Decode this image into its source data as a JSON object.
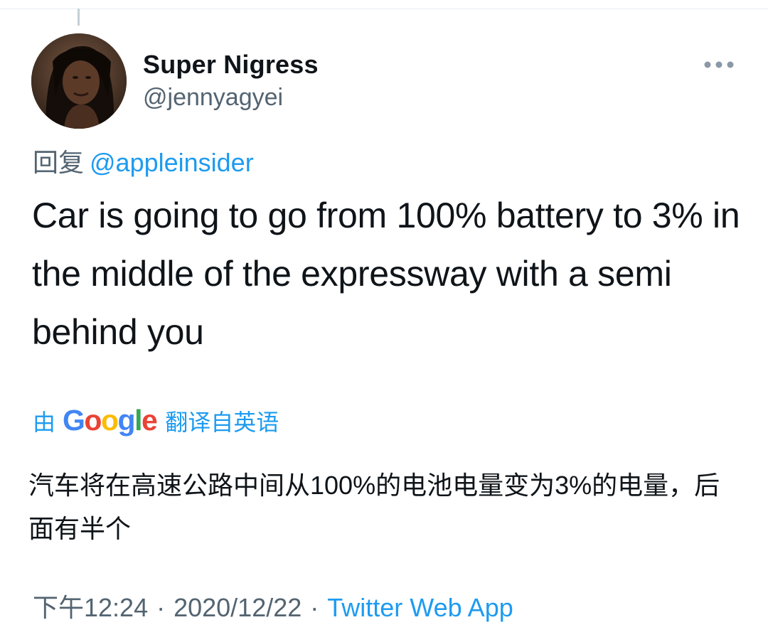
{
  "tweet": {
    "author": {
      "display_name": "Super Nigress",
      "handle": "@jennyagyei"
    },
    "more_icon": "more-horizontal-icon",
    "reply_prefix": "回复",
    "reply_to": "@appleinsider",
    "text": "Car is going to go from 100% battery to 3% in the middle of the expressway with a semi behind you",
    "translation": {
      "prefix": "由",
      "provider_logo": "Google",
      "suffix": "翻译自英语",
      "text": "汽车将在高速公路中间从100%的电池电量变为3%的电量，后面有半个"
    },
    "meta": {
      "time": "下午12:24",
      "separator": "·",
      "date": "2020/12/22",
      "source": "Twitter Web App"
    }
  },
  "colors": {
    "accent": "#1d9bf0",
    "secondary_text": "#536471",
    "primary_text": "#0f1419",
    "google_blue": "#4285f4",
    "google_red": "#ea4335",
    "google_yellow": "#fbbc05",
    "google_green": "#34a853"
  }
}
